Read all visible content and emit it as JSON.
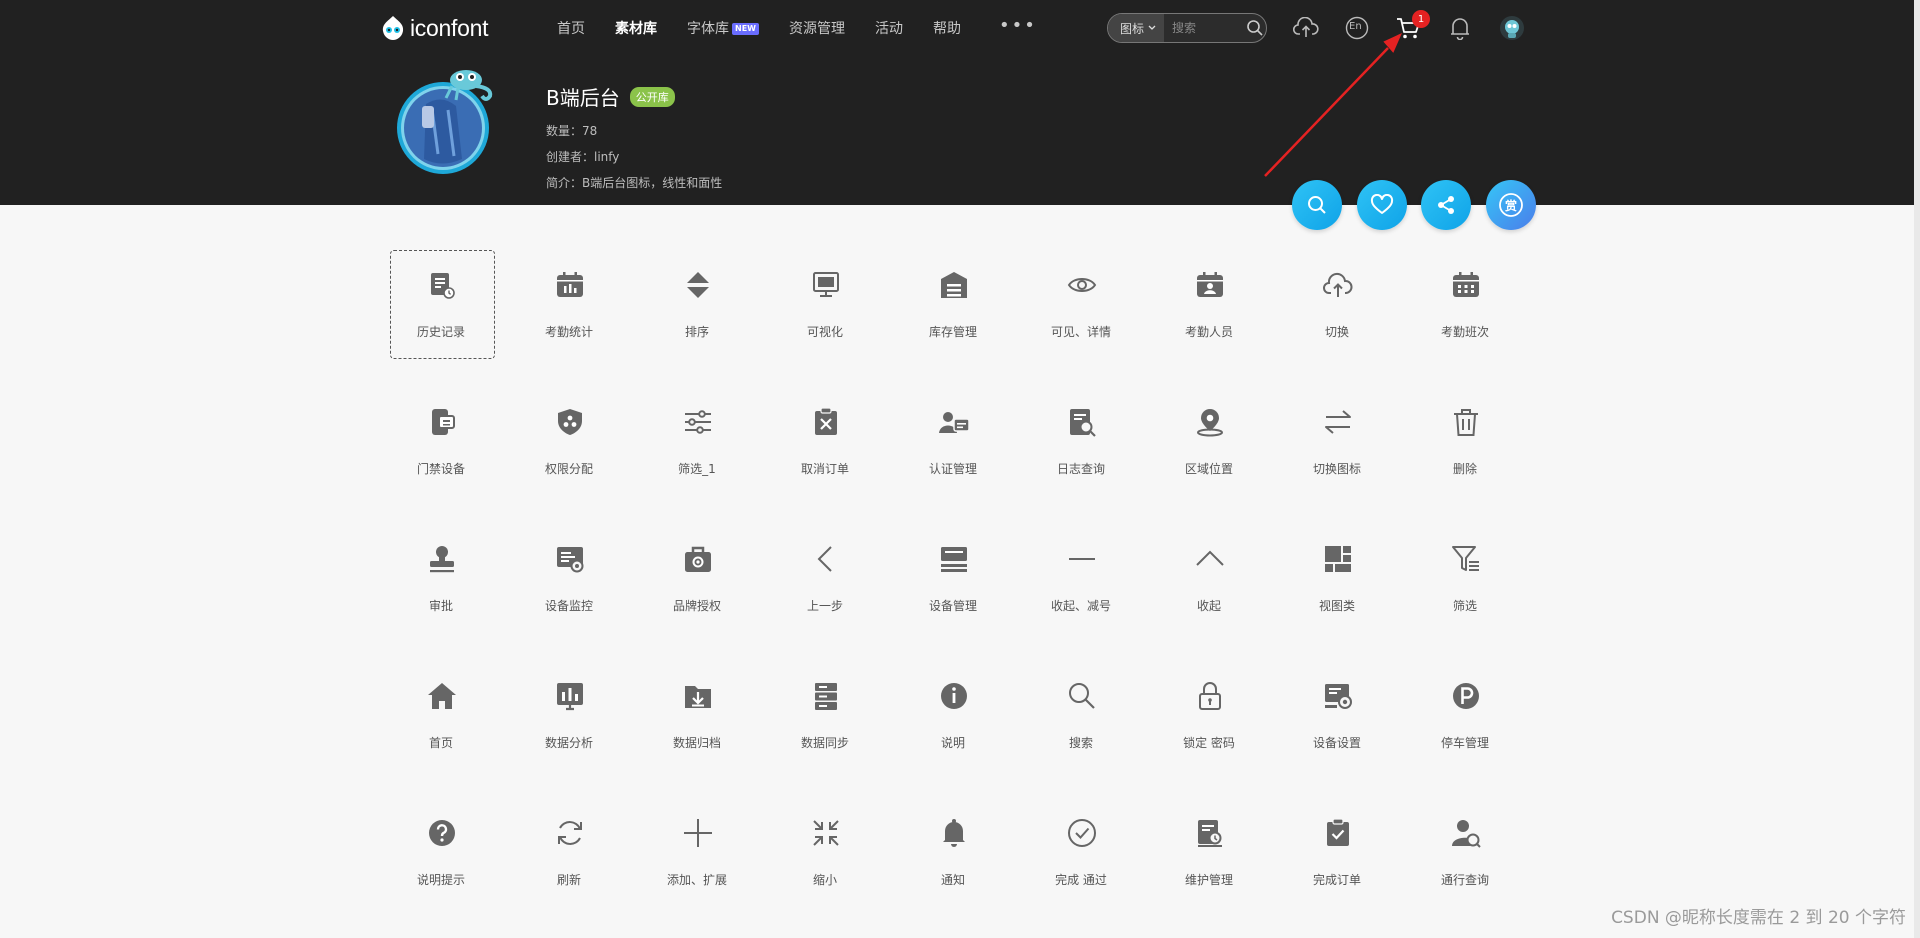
{
  "brand": {
    "name": "iconfont"
  },
  "nav": {
    "items": [
      {
        "label": "首页"
      },
      {
        "label": "素材库",
        "active": true
      },
      {
        "label": "字体库",
        "badge": "NEW"
      },
      {
        "label": "资源管理"
      },
      {
        "label": "活动"
      },
      {
        "label": "帮助"
      }
    ],
    "more": "•••"
  },
  "search": {
    "type_label": "图标",
    "placeholder": "搜索"
  },
  "toolbar": {
    "upload_icon": "cloud-upload-icon",
    "language_label": "En",
    "cart_count": "1",
    "bell_icon": "bell-icon"
  },
  "project": {
    "title": "B端后台",
    "badge": "公开库",
    "count_text": "数量：78",
    "creator_text": "创建者：linfy",
    "intro_text": "简介：B端后台图标，线性和面性"
  },
  "actions": {
    "reward_label": "赏"
  },
  "colors": {
    "header_bg": "#212121",
    "page_bg": "#f7f7f7",
    "icon": "#666666",
    "accent": "#1eb6f0",
    "badge_green": "#8bc34a",
    "cart_badge": "#e52222",
    "annotation_arrow": "#e52222"
  },
  "icons": [
    {
      "label": "历史记录",
      "icon": "history-record-icon",
      "selected": true
    },
    {
      "label": "考勤统计",
      "icon": "attendance-stats-icon"
    },
    {
      "label": "排序",
      "icon": "sort-icon"
    },
    {
      "label": "可视化",
      "icon": "monitor-icon"
    },
    {
      "label": "库存管理",
      "icon": "warehouse-icon"
    },
    {
      "label": "可见、详情",
      "icon": "eye-icon"
    },
    {
      "label": "考勤人员",
      "icon": "attendance-person-icon"
    },
    {
      "label": "切换",
      "icon": "cloud-switch-icon"
    },
    {
      "label": "考勤班次",
      "icon": "attendance-shift-icon"
    },
    {
      "label": "门禁设备",
      "icon": "access-device-icon"
    },
    {
      "label": "权限分配",
      "icon": "permission-shield-icon"
    },
    {
      "label": "筛选_1",
      "icon": "sliders-icon"
    },
    {
      "label": "取消订单",
      "icon": "cancel-order-icon"
    },
    {
      "label": "认证管理",
      "icon": "auth-card-icon"
    },
    {
      "label": "日志查询",
      "icon": "log-search-icon"
    },
    {
      "label": "区域位置",
      "icon": "location-pin-icon"
    },
    {
      "label": "切换图标",
      "icon": "swap-arrows-icon"
    },
    {
      "label": "删除",
      "icon": "trash-icon"
    },
    {
      "label": "审批",
      "icon": "approval-stamp-icon"
    },
    {
      "label": "设备监控",
      "icon": "device-monitor-icon"
    },
    {
      "label": "品牌授权",
      "icon": "brand-auth-icon"
    },
    {
      "label": "上一步",
      "icon": "chevron-left-icon"
    },
    {
      "label": "设备管理",
      "icon": "device-manage-icon"
    },
    {
      "label": "收起、减号",
      "icon": "minus-icon"
    },
    {
      "label": "收起",
      "icon": "chevron-up-icon"
    },
    {
      "label": "视图类",
      "icon": "view-grid-icon"
    },
    {
      "label": "筛选",
      "icon": "filter-list-icon"
    },
    {
      "label": "首页",
      "icon": "home-icon"
    },
    {
      "label": "数据分析",
      "icon": "data-analysis-icon"
    },
    {
      "label": "数据归档",
      "icon": "archive-folder-icon"
    },
    {
      "label": "数据同步",
      "icon": "data-sync-icon"
    },
    {
      "label": "说明",
      "icon": "info-icon"
    },
    {
      "label": "搜索",
      "icon": "search-icon"
    },
    {
      "label": "锁定 密码",
      "icon": "lock-icon"
    },
    {
      "label": "设备设置",
      "icon": "device-settings-icon"
    },
    {
      "label": "停车管理",
      "icon": "parking-icon"
    },
    {
      "label": "说明提示",
      "icon": "help-icon"
    },
    {
      "label": "刷新",
      "icon": "refresh-icon"
    },
    {
      "label": "添加、扩展",
      "icon": "plus-icon"
    },
    {
      "label": "缩小",
      "icon": "shrink-icon"
    },
    {
      "label": "通知",
      "icon": "notify-bell-icon"
    },
    {
      "label": "完成 通过",
      "icon": "check-circle-icon"
    },
    {
      "label": "维护管理",
      "icon": "maintenance-icon"
    },
    {
      "label": "完成订单",
      "icon": "order-done-icon"
    },
    {
      "label": "通行查询",
      "icon": "access-query-icon"
    }
  ],
  "watermark": "CSDN @昵称长度需在 2 到 20 个字符"
}
